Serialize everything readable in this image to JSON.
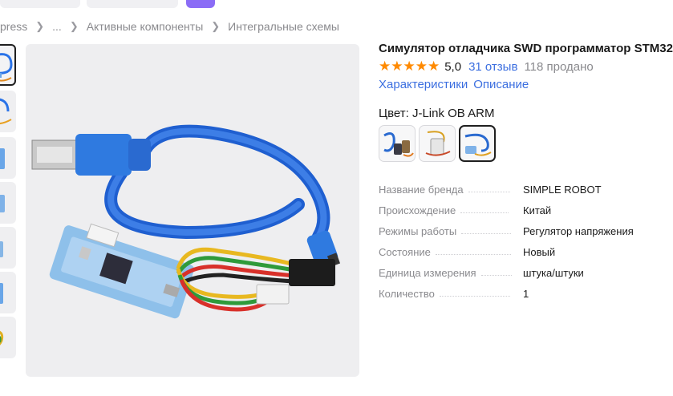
{
  "breadcrumb": {
    "items": [
      "press",
      "...",
      "Активные компоненты",
      "Интегральные схемы"
    ]
  },
  "product": {
    "title": "Симулятор отладчика SWD программатор STM32",
    "stars": "★★★★★",
    "rating": "5,0",
    "reviews": "31 отзыв",
    "sold": "118 продано",
    "tabs": [
      "Характеристики",
      "Описание"
    ],
    "color_label": "Цвет: J-Link OB ARM",
    "selected_variant_index": 2
  },
  "specs": [
    {
      "key": "Название бренда",
      "value": "SIMPLE ROBOT"
    },
    {
      "key": "Происхождение",
      "value": "Китай"
    },
    {
      "key": "Режимы работы",
      "value": "Регулятор напряжения"
    },
    {
      "key": "Состояние",
      "value": "Новый"
    },
    {
      "key": "Единица измерения",
      "value": "штука/штуки"
    },
    {
      "key": "Количество",
      "value": "1"
    }
  ],
  "colors": {
    "link": "#3c6fe0",
    "star": "#ff8a00",
    "accent_pill": "#8b6cf6",
    "cable_blue": "#1f6fe0"
  }
}
